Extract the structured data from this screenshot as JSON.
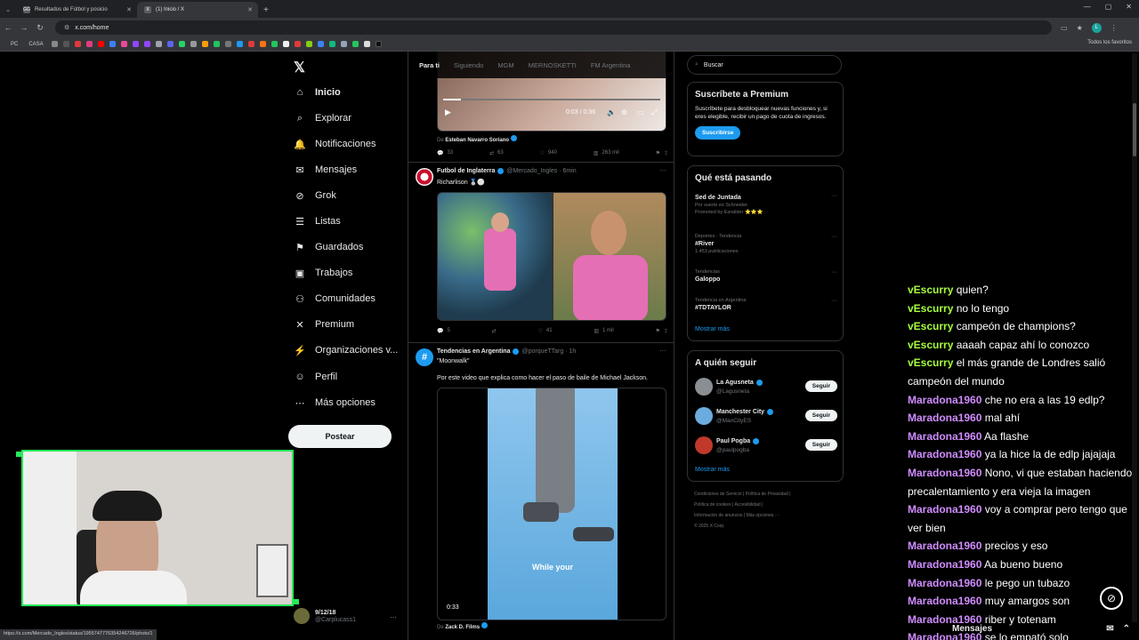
{
  "browser": {
    "tabs": [
      {
        "fav": "GG",
        "title": "Resultados de Fútbol y posicio",
        "active": false
      },
      {
        "fav": "X",
        "title": "(1) Inicio / X",
        "active": true
      }
    ],
    "url": "x.com/home",
    "bookmarks": [
      "PC",
      "CASA"
    ],
    "all_bookmarks": "Todos los favoritos",
    "status_url": "https://x.com/Mercado_Ingles/status/1955747776354246726/photo/1"
  },
  "nav": {
    "items": [
      {
        "icon": "home-icon",
        "glyph": "⌂",
        "label": "Inicio"
      },
      {
        "icon": "search-icon",
        "glyph": "⌕",
        "label": "Explorar"
      },
      {
        "icon": "bell-icon",
        "glyph": "🔔",
        "label": "Notificaciones"
      },
      {
        "icon": "mail-icon",
        "glyph": "✉",
        "label": "Mensajes"
      },
      {
        "icon": "grok-icon",
        "glyph": "⊘",
        "label": "Grok"
      },
      {
        "icon": "list-icon",
        "glyph": "☰",
        "label": "Listas"
      },
      {
        "icon": "bookmark-icon",
        "glyph": "⚑",
        "label": "Guardados"
      },
      {
        "icon": "briefcase-icon",
        "glyph": "▣",
        "label": "Trabajos"
      },
      {
        "icon": "community-icon",
        "glyph": "⚇",
        "label": "Comunidades"
      },
      {
        "icon": "x-logo-icon",
        "glyph": "✕",
        "label": "Premium"
      },
      {
        "icon": "lightning-icon",
        "glyph": "⚡",
        "label": "Organizaciones v..."
      },
      {
        "icon": "profile-icon",
        "glyph": "☺",
        "label": "Perfil"
      },
      {
        "icon": "more-icon",
        "glyph": "⋯",
        "label": "Más opciones"
      }
    ],
    "post_label": "Postear",
    "account": {
      "name": "9/12/18",
      "handle": "@Carplucass1"
    }
  },
  "feed": {
    "tabs": [
      "Para ti",
      "Siguiendo",
      "MGM",
      "MERNOSKETTI",
      "FM Argentina"
    ],
    "video1": {
      "time": "0:03 / 0:36",
      "from_label": "De",
      "from": "Esteban Navarro Soriano",
      "stats": [
        "33",
        "63",
        "940",
        "263 mil"
      ]
    },
    "tweet2": {
      "name": "Futbol de Inglaterra",
      "handle": "@Mercado_Ingles · 6min",
      "text": "Richarlison 🥈⚪",
      "stats": [
        "5",
        "",
        "41",
        "1 mil"
      ]
    },
    "tweet3": {
      "name": "Tendencias en Argentina",
      "handle": "@porqueTTarg · 1h",
      "text1": "\"Moonwalk\"",
      "text2": "Por este video que explica como hacer el paso de baile de Michael Jackson.",
      "video_caption": "While your",
      "video_time": "0:33",
      "from_label": "De",
      "from": "Zack D. Films"
    }
  },
  "sidebar": {
    "search_placeholder": "Buscar",
    "premium": {
      "title": "Suscríbete a Premium",
      "text": "Suscríbete para desbloquear nuevas funciones y, si eres elegible, recibir un pago de cuota de ingresos.",
      "button": "Suscribirse"
    },
    "trends_title": "Qué está pasando",
    "trends": [
      {
        "cat": "",
        "title": "Sed de Juntada",
        "count": "Por suerte es Schneider.",
        "extra": "Promoted by Esnálder ⭐⭐⭐"
      },
      {
        "cat": "Deportes · Tendencia",
        "title": "#River",
        "count": "1.453 publicaciones",
        "extra": ""
      },
      {
        "cat": "Tendencias",
        "title": "Galoppo",
        "count": "",
        "extra": ""
      },
      {
        "cat": "Tendencia en Argentina",
        "title": "#TDTAYLOR",
        "count": "",
        "extra": ""
      }
    ],
    "show_more": "Mostrar más",
    "follow_title": "A quién seguir",
    "follow": [
      {
        "name": "La Agusneta",
        "handle": "@Lagusneta",
        "button": "Seguir",
        "color": "#8a8f94"
      },
      {
        "name": "Manchester City",
        "handle": "@ManCityES",
        "button": "Seguir",
        "color": "#6cabdd"
      },
      {
        "name": "Paul Pogba",
        "handle": "@paulpogba",
        "button": "Seguir",
        "color": "#c0392b"
      }
    ],
    "show_more2": "Mostrar más",
    "footer": [
      "Condiciones de Servicio",
      "Política de Privacidad",
      "Política de cookies",
      "Accesibilidad",
      "Información de anuncios",
      "Más opciones ···",
      "© 2025 X Corp."
    ]
  },
  "chat": [
    {
      "user": "vEscurry",
      "msg": "quien?"
    },
    {
      "user": "vEscurry",
      "msg": "no lo tengo"
    },
    {
      "user": "vEscurry",
      "msg": "campeón de champions?"
    },
    {
      "user": "vEscurry",
      "msg": "aaaah capaz ahí lo conozco"
    },
    {
      "user": "vEscurry",
      "msg": "el más grande de Londres salió campeón del mundo"
    },
    {
      "user": "Maradona1960",
      "msg": "che no era a las 19 edlp?"
    },
    {
      "user": "Maradona1960",
      "msg": "mal ahí"
    },
    {
      "user": "Maradona1960",
      "msg": "Aa flashe"
    },
    {
      "user": "Maradona1960",
      "msg": "ya la hice la de edlp jajajaja"
    },
    {
      "user": "Maradona1960",
      "msg": "Nono, vi que estaban haciendo precalentamiento y era vieja la imagen"
    },
    {
      "user": "Maradona1960",
      "msg": "voy a comprar pero tengo que ver bien"
    },
    {
      "user": "Maradona1960",
      "msg": "precios y eso"
    },
    {
      "user": "Maradona1960",
      "msg": "Aa bueno bueno"
    },
    {
      "user": "Maradona1960",
      "msg": "le pego un tubazo"
    },
    {
      "user": "Maradona1960",
      "msg": "muy amargos son"
    },
    {
      "user": "Maradona1960",
      "msg": "riber y totenam"
    },
    {
      "user": "Maradona1960",
      "msg": "se lo empató solo"
    }
  ],
  "messages_bar": "Mensajes"
}
